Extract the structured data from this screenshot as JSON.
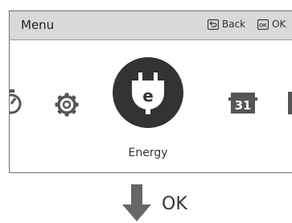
{
  "header": {
    "title": "Menu",
    "back_label": "Back",
    "back_icon": "back-key-icon",
    "ok_label": "OK",
    "ok_icon": "ok-key-icon"
  },
  "carousel": {
    "items": [
      {
        "icon": "timer-icon"
      },
      {
        "icon": "gear-icon"
      },
      {
        "icon": "energy-plug-icon",
        "label": "Energy",
        "selected": true,
        "glyph": "e"
      },
      {
        "icon": "calendar-icon",
        "glyph": "31"
      },
      {
        "icon": "next-item-icon"
      }
    ]
  },
  "instruction": {
    "icon": "arrow-down-icon",
    "label": "OK"
  },
  "colors": {
    "header_bg": "#d9d9d9",
    "selected_disc": "#333333",
    "icon": "#555555",
    "arrow": "#666666"
  }
}
